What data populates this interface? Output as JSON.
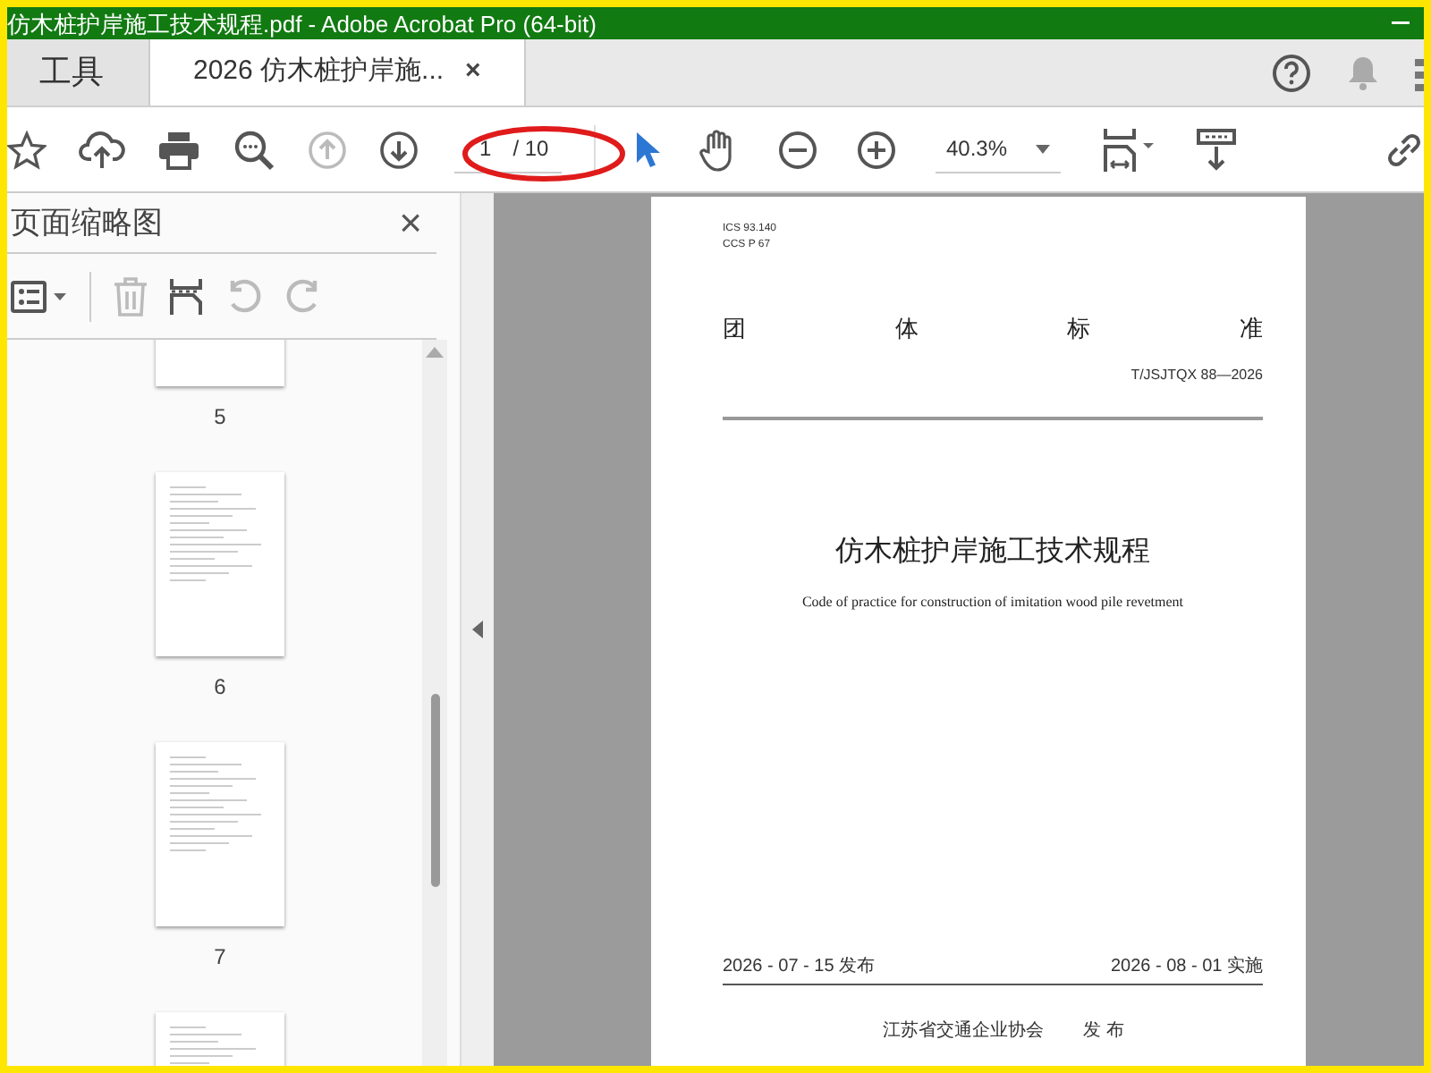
{
  "window": {
    "title": "仿木桩护岸施工技术规程.pdf - Adobe Acrobat Pro (64-bit)"
  },
  "tabs": [
    {
      "label": "工具",
      "selected": false
    },
    {
      "label": "2026 仿木桩护岸施...",
      "selected": true,
      "close": "×"
    }
  ],
  "toolbar": {
    "page_current": "1",
    "page_total": "/ 10",
    "zoom": "40.3%"
  },
  "panel": {
    "title": "页面缩略图",
    "close": "×",
    "thumbnails": [
      {
        "page": "5"
      },
      {
        "page": "6"
      },
      {
        "page": "7"
      }
    ]
  },
  "document": {
    "ics": "ICS 93.140",
    "ccs": "CCS P 67",
    "heading": [
      "团",
      "体",
      "标",
      "准"
    ],
    "code": "T/JSJTQX 88—2026",
    "title": "仿木桩护岸施工技术规程",
    "subtitle": "Code of practice for construction of imitation wood pile revetment",
    "issue_date": "2026 - 07 - 15 发布",
    "effective_date": "2026 - 08 - 01 实施",
    "publisher": "江苏省交通企业协会",
    "publish_label": "发 布"
  }
}
